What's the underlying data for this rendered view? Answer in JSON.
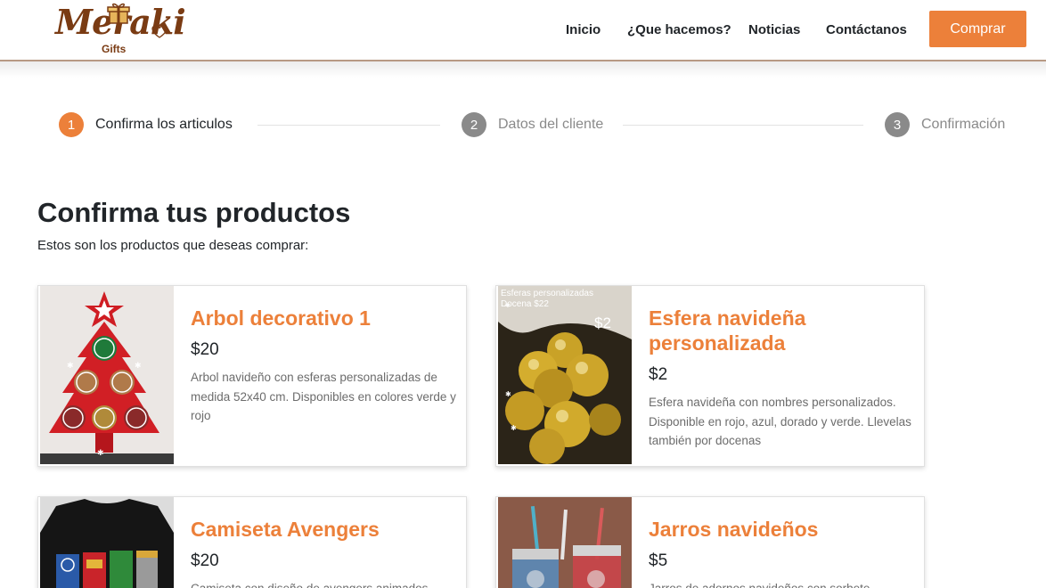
{
  "brand": {
    "name": "Meraki",
    "sub": "Gifts",
    "color": "#7a3b13"
  },
  "nav": {
    "items": [
      "Inicio",
      "¿Que hacemos?",
      "Noticias",
      "Contáctanos"
    ],
    "buy_label": "Comprar",
    "accent": "#ec803a"
  },
  "stepper": {
    "steps": [
      {
        "number": "1",
        "label": "Confirma los articulos",
        "state": "active"
      },
      {
        "number": "2",
        "label": "Datos del cliente",
        "state": "pending"
      },
      {
        "number": "3",
        "label": "Confirmación",
        "state": "pending"
      }
    ],
    "active_color": "#ec803a",
    "pending_color": "#8a8a8a"
  },
  "page": {
    "title": "Confirma tus productos",
    "subtitle": "Estos son los productos que deseas comprar:"
  },
  "products": [
    {
      "title": "Arbol decorativo 1",
      "price": "$20",
      "description": "Arbol navideño con esferas personalizadas de medida 52x40 cm. Disponibles en colores verde y rojo",
      "image": "red-christmas-tree-ornament-photo"
    },
    {
      "title": "Esfera navideña personalizada",
      "price": "$2",
      "description": "Esfera navideña con nombres personalizados. Disponible en rojo, azul, dorado y verde. Llevelas también por docenas",
      "image": "gold-ornaments-photo",
      "image_overlay": [
        "Esferas personalizadas",
        "Docena $22",
        "$2"
      ]
    },
    {
      "title": "Camiseta Avengers",
      "price": "$20",
      "description": "Camiseta con diseño de avengers animados",
      "image": "avengers-tshirt-photo"
    },
    {
      "title": "Jarros navideños",
      "price": "$5",
      "description": "Jarros de adornos navideños con sorbete",
      "image": "christmas-mason-jars-photo"
    }
  ]
}
